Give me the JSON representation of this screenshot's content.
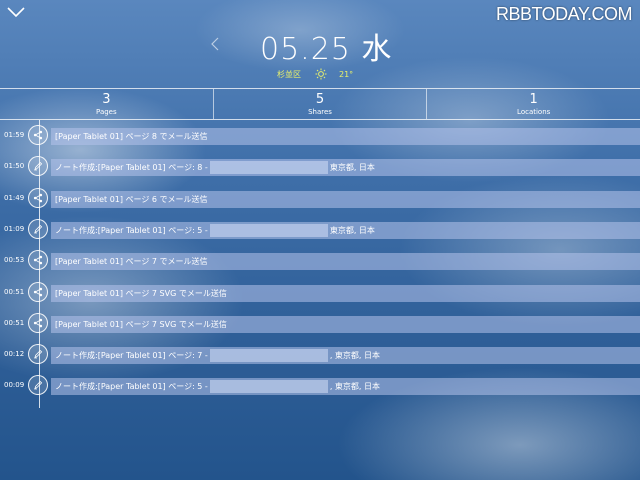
{
  "header": {
    "watermark": "RBBTODAY.COM",
    "date": "05.25 水",
    "location": "杉並区",
    "temperature": "21°"
  },
  "stats": [
    {
      "value": "3",
      "label": "Pages"
    },
    {
      "value": "5",
      "label": "Shares"
    },
    {
      "value": "1",
      "label": "Locations"
    }
  ],
  "entries": [
    {
      "time": "01:59",
      "icon": "share-icon",
      "text": "[Paper Tablet 01] ページ 8 でメール送信"
    },
    {
      "time": "01:50",
      "icon": "pen-icon",
      "text": "ノート作成:[Paper Tablet 01] ページ: 8 -",
      "location": "東京都, 日本"
    },
    {
      "time": "01:49",
      "icon": "share-icon",
      "text": "[Paper Tablet 01] ページ 6 でメール送信"
    },
    {
      "time": "01:09",
      "icon": "pen-icon",
      "text": "ノート作成:[Paper Tablet 01] ページ: 5 -",
      "location": "東京都, 日本"
    },
    {
      "time": "00:53",
      "icon": "share-icon",
      "text": "[Paper Tablet 01] ページ 7 でメール送信"
    },
    {
      "time": "00:51",
      "icon": "share-icon",
      "text": "[Paper Tablet 01] ページ 7 SVG でメール送信"
    },
    {
      "time": "00:51",
      "icon": "share-icon",
      "text": "[Paper Tablet 01] ページ 7 SVG でメール送信"
    },
    {
      "time": "00:12",
      "icon": "pen-icon",
      "text": "ノート作成:[Paper Tablet 01] ページ: 7 -",
      "location": ", 東京都, 日本"
    },
    {
      "time": "00:09",
      "icon": "pen-icon",
      "text": "ノート作成:[Paper Tablet 01] ページ: 5 -",
      "location": ", 東京都, 日本"
    }
  ]
}
